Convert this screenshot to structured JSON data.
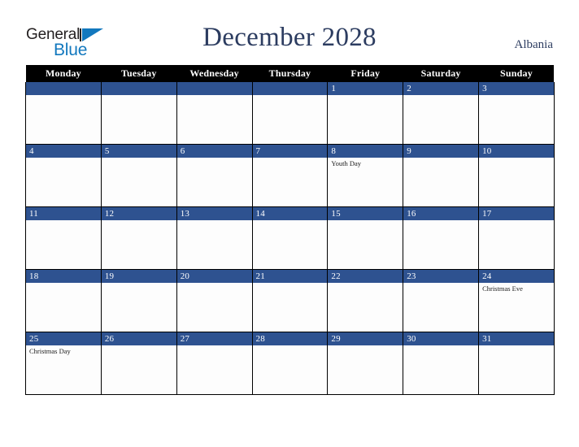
{
  "brand": {
    "name_part1": "General",
    "name_part2": "Blue",
    "triangle_color": "#1278be",
    "text_color": "#231f20"
  },
  "header": {
    "title": "December 2028",
    "country": "Albania",
    "title_color": "#2c3c60"
  },
  "calendar": {
    "weekday_header_bg": "#000000",
    "weekday_header_color": "#ffffff",
    "daybar_color": "#2e5290",
    "cell_bg": "#fdfdfd",
    "grid_color": "#000000",
    "weekdays": [
      "Monday",
      "Tuesday",
      "Wednesday",
      "Thursday",
      "Friday",
      "Saturday",
      "Sunday"
    ],
    "weeks": [
      [
        {
          "day": "",
          "events": []
        },
        {
          "day": "",
          "events": []
        },
        {
          "day": "",
          "events": []
        },
        {
          "day": "",
          "events": []
        },
        {
          "day": "1",
          "events": []
        },
        {
          "day": "2",
          "events": []
        },
        {
          "day": "3",
          "events": []
        }
      ],
      [
        {
          "day": "4",
          "events": []
        },
        {
          "day": "5",
          "events": []
        },
        {
          "day": "6",
          "events": []
        },
        {
          "day": "7",
          "events": []
        },
        {
          "day": "8",
          "events": [
            "Youth Day"
          ]
        },
        {
          "day": "9",
          "events": []
        },
        {
          "day": "10",
          "events": []
        }
      ],
      [
        {
          "day": "11",
          "events": []
        },
        {
          "day": "12",
          "events": []
        },
        {
          "day": "13",
          "events": []
        },
        {
          "day": "14",
          "events": []
        },
        {
          "day": "15",
          "events": []
        },
        {
          "day": "16",
          "events": []
        },
        {
          "day": "17",
          "events": []
        }
      ],
      [
        {
          "day": "18",
          "events": []
        },
        {
          "day": "19",
          "events": []
        },
        {
          "day": "20",
          "events": []
        },
        {
          "day": "21",
          "events": []
        },
        {
          "day": "22",
          "events": []
        },
        {
          "day": "23",
          "events": []
        },
        {
          "day": "24",
          "events": [
            "Christmas Eve"
          ]
        }
      ],
      [
        {
          "day": "25",
          "events": [
            "Christmas Day"
          ]
        },
        {
          "day": "26",
          "events": []
        },
        {
          "day": "27",
          "events": []
        },
        {
          "day": "28",
          "events": []
        },
        {
          "day": "29",
          "events": []
        },
        {
          "day": "30",
          "events": []
        },
        {
          "day": "31",
          "events": []
        }
      ]
    ]
  }
}
